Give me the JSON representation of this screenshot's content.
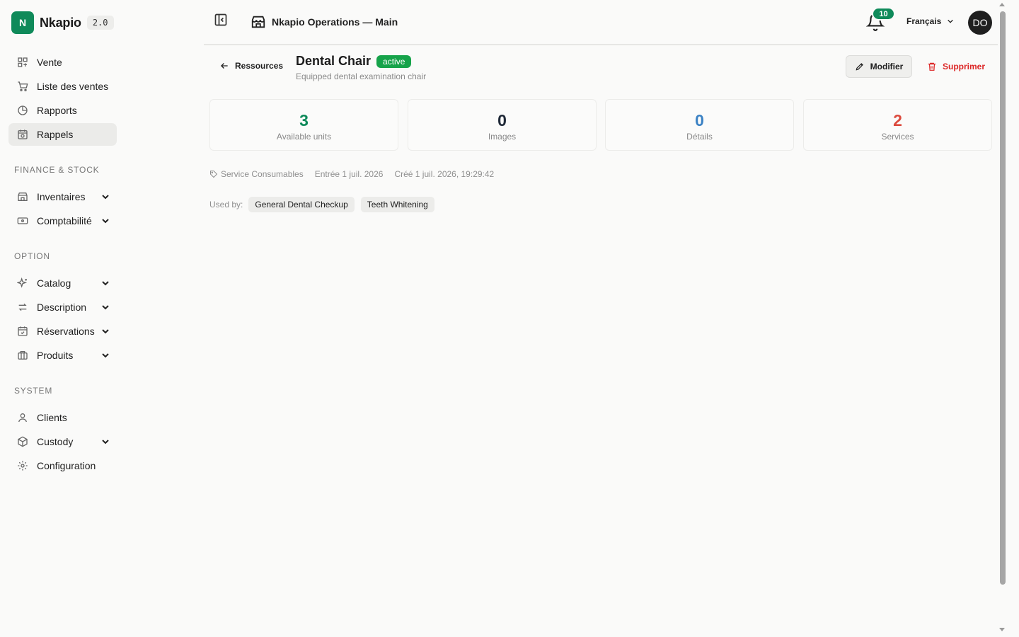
{
  "brand": {
    "letter": "N",
    "name": "Nkapio",
    "version": "2.0"
  },
  "sidebar": {
    "top_items": [
      {
        "label": "Vente",
        "icon": "grid-icon"
      },
      {
        "label": "Liste des ventes",
        "icon": "cart-icon"
      },
      {
        "label": "Rapports",
        "icon": "pie-chart-icon"
      },
      {
        "label": "Rappels",
        "icon": "calendar-clock-icon",
        "active": true
      }
    ],
    "sections": [
      {
        "title": "FINANCE & STOCK",
        "items": [
          {
            "label": "Inventaires",
            "icon": "store-icon",
            "expandable": true
          },
          {
            "label": "Comptabilité",
            "icon": "banknote-icon",
            "expandable": true
          }
        ]
      },
      {
        "title": "OPTION",
        "items": [
          {
            "label": "Catalog",
            "icon": "sparkles-icon",
            "expandable": true
          },
          {
            "label": "Description",
            "icon": "arrows-swap-icon",
            "expandable": true
          },
          {
            "label": "Réservations",
            "icon": "calendar-check-icon",
            "expandable": true
          },
          {
            "label": "Produits",
            "icon": "briefcase-icon",
            "expandable": true
          }
        ]
      },
      {
        "title": "SYSTEM",
        "items": [
          {
            "label": "Clients",
            "icon": "user-icon"
          },
          {
            "label": "Custody",
            "icon": "box-icon",
            "expandable": true
          },
          {
            "label": "Configuration",
            "icon": "gear-icon"
          }
        ]
      }
    ]
  },
  "header": {
    "org_name": "Nkapio Operations — Main",
    "notifications_count": "10",
    "language": "Français",
    "avatar_initials": "DO"
  },
  "resource": {
    "back_label": "Ressources",
    "title": "Dental Chair",
    "status": "active",
    "description": "Equipped dental examination chair",
    "edit_label": "Modifier",
    "delete_label": "Supprimer"
  },
  "stats": [
    {
      "value": "3",
      "label": "Available units",
      "color": "#0f8a5a"
    },
    {
      "value": "0",
      "label": "Images",
      "color": "#1f2937"
    },
    {
      "value": "0",
      "label": "Détails",
      "color": "#3b82c4"
    },
    {
      "value": "2",
      "label": "Services",
      "color": "#dc4a3d"
    }
  ],
  "meta": {
    "category": "Service Consumables",
    "entry": "Entrée 1 juil. 2026",
    "created": "Créé 1 juil. 2026, 19:29:42"
  },
  "used_by": {
    "label": "Used by:",
    "items": [
      "General Dental Checkup",
      "Teeth Whitening"
    ]
  },
  "colors": {
    "accent": "#0f8a5a",
    "danger": "#dc2626",
    "active_badge": "#16a34a"
  }
}
